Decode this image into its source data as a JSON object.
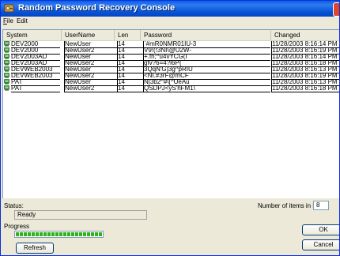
{
  "window": {
    "title": "Random Password Recovery Console"
  },
  "menu": [
    {
      "accel": "F",
      "rest": "ile"
    },
    {
      "accel": "",
      "rest": "Edit"
    }
  ],
  "columns": [
    "System",
    "UserName",
    "Len",
    "Password",
    "Changed"
  ],
  "rows": [
    {
      "system": "DEV2000",
      "user": "NewUser",
      "len": "14",
      "password": "`#mR0NMR01IU-3",
      "changed": "11/28/2003 8:16:14 PM"
    },
    {
      "system": "DEV2000",
      "user": "NewUser2",
      "len": "14",
      "password": "V9!(!3NI\\@U2W-",
      "changed": "11/28/2003 8:16:19 PM"
    },
    {
      "system": "DEV2003AD",
      "user": "NewUser",
      "len": "14",
      "password": "+.fh;^u4vYCG(I",
      "changed": "11/28/2003 8:16:14 PM"
    },
    {
      "system": "DEV2003AD",
      "user": "NewUser2",
      "len": "14",
      "password": "gfv?6=4?i6P{",
      "changed": "11/28/2003 8:16:18 PM"
    },
    {
      "system": "DEVWEB2003",
      "user": "NewUser",
      "len": "14",
      "password": "3QqN'G]3g^pRIU",
      "changed": "11/28/2003 8:16:13 PM"
    },
    {
      "system": "DEVWEB2003",
      "user": "NewUser2",
      "len": "14",
      "password": "<NI.#3rF@mCF`",
      "changed": "11/28/2003 8:16:19 PM"
    },
    {
      "system": "PAT",
      "user": "NewUser",
      "len": "14",
      "password": "N|3b2^#\\[^UeAu",
      "changed": "11/28/2003 8:16:13 PM"
    },
    {
      "system": "PAT",
      "user": "NewUser2",
      "len": "14",
      "password": "QSDPJ<yS'hFM1\\",
      "changed": "11/28/2003 8:16:18 PM"
    }
  ],
  "status": {
    "label": "Status:",
    "value": "Ready"
  },
  "count": {
    "label": "Number of items in list:",
    "value": "8"
  },
  "progress": {
    "label": "Progress",
    "fraction": 1.0
  },
  "buttons": {
    "refresh": "Refresh",
    "ok": "OK",
    "cancel": "Cancel"
  },
  "icons": {
    "row": "computer-icon",
    "title": "key-icon"
  }
}
